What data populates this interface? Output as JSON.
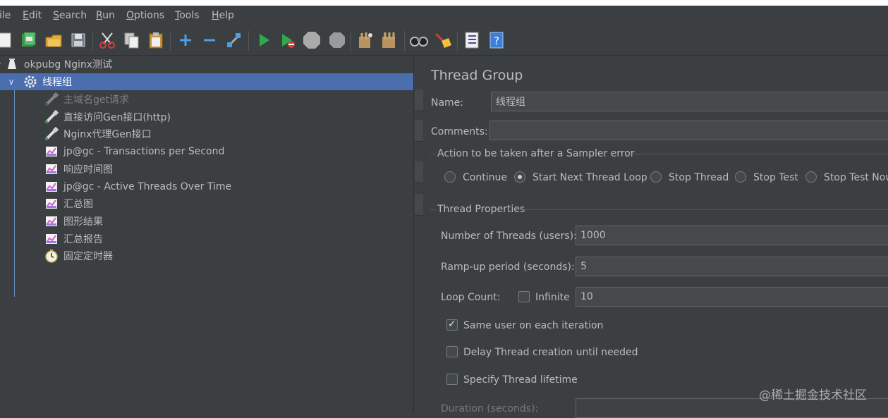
{
  "menu": {
    "items": [
      {
        "label": "ile",
        "mnemonic": ""
      },
      {
        "label": "dit",
        "mnemonic": "E"
      },
      {
        "label": "earch",
        "mnemonic": "S"
      },
      {
        "label": "un",
        "mnemonic": "R"
      },
      {
        "label": "ptions",
        "mnemonic": "O"
      },
      {
        "label": "ools",
        "mnemonic": "T"
      },
      {
        "label": "elp",
        "mnemonic": "H"
      }
    ]
  },
  "toolbar": {
    "icons": [
      "new-icon",
      "templates-icon",
      "open-icon",
      "save-icon",
      "cut-icon",
      "copy-icon",
      "paste-icon",
      "expand-icon",
      "collapse-icon",
      "toggle-icon",
      "start-icon",
      "start-no-pauses-icon",
      "stop-icon",
      "shutdown-icon",
      "clear-icon",
      "clear-all-icon",
      "search-icon",
      "reset-search-icon",
      "function-helper-icon",
      "help-icon"
    ],
    "colors": {
      "green": "#2fa84f",
      "blue": "#4a9fe8",
      "red": "#d83b3b",
      "gray": "#aaaaaa"
    }
  },
  "tree": {
    "root": "okpubg Nginx测试",
    "selected": "线程组",
    "children": [
      {
        "label": "主域名get请求",
        "icon": "sampler-icon",
        "disabled": true
      },
      {
        "label": "直接访问Gen接口(http)",
        "icon": "sampler-icon",
        "disabled": false
      },
      {
        "label": "Nginx代理Gen接口",
        "icon": "sampler-icon",
        "disabled": false
      },
      {
        "label": "jp@gc - Transactions per Second",
        "icon": "listener-icon",
        "disabled": false
      },
      {
        "label": "响应时间图",
        "icon": "listener-icon",
        "disabled": false
      },
      {
        "label": "jp@gc - Active Threads Over Time",
        "icon": "listener-icon",
        "disabled": false
      },
      {
        "label": "汇总图",
        "icon": "listener-icon",
        "disabled": false
      },
      {
        "label": "图形结果",
        "icon": "listener-icon",
        "disabled": false
      },
      {
        "label": "汇总报告",
        "icon": "listener-icon",
        "disabled": false
      },
      {
        "label": "固定定时器",
        "icon": "timer-icon",
        "disabled": false
      }
    ]
  },
  "panel": {
    "title": "Thread Group",
    "name_label": "Name:",
    "name_value": "线程组",
    "comments_label": "Comments:",
    "comments_value": "",
    "sampler_error": {
      "legend": "Action to be taken after a Sampler error",
      "options": [
        "Continue",
        "Start Next Thread Loop",
        "Stop Thread",
        "Stop Test",
        "Stop Test Now"
      ],
      "selected": "Start Next Thread Loop"
    },
    "props": {
      "legend": "Thread Properties",
      "threads_label": "Number of Threads (users):",
      "threads_value": "1000",
      "rampup_label": "Ramp-up period (seconds):",
      "rampup_value": "5",
      "loop_label": "Loop Count:",
      "infinite_label": "Infinite",
      "infinite_checked": false,
      "loop_value": "10",
      "same_user_label": "Same user on each iteration",
      "same_user_checked": true,
      "delay_label": "Delay Thread creation until needed",
      "delay_checked": false,
      "lifetime_label": "Specify Thread lifetime",
      "lifetime_checked": false,
      "duration_label": "Duration (seconds):"
    }
  },
  "watermark": "@稀土掘金技术社区"
}
